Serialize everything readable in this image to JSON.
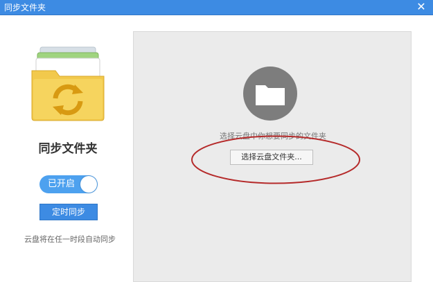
{
  "window": {
    "title": "同步文件夹",
    "close_label": "✕"
  },
  "sidebar": {
    "folder_title": "同步文件夹",
    "toggle_label": "已开启",
    "toggle_on": true,
    "schedule_button_label": "定时同步",
    "auto_sync_text": "云盘将在任一时段自动同步"
  },
  "main": {
    "prompt_text": "选择云盘中你想要同步的文件夹",
    "select_button_label": "选择云盘文件夹..."
  },
  "colors": {
    "titlebar": "#3d8be3",
    "accent": "#4da1ef",
    "folder_yellow": "#f2c94c",
    "icon_circle": "#7d7d7d",
    "annotation_red": "#b52a2a"
  }
}
